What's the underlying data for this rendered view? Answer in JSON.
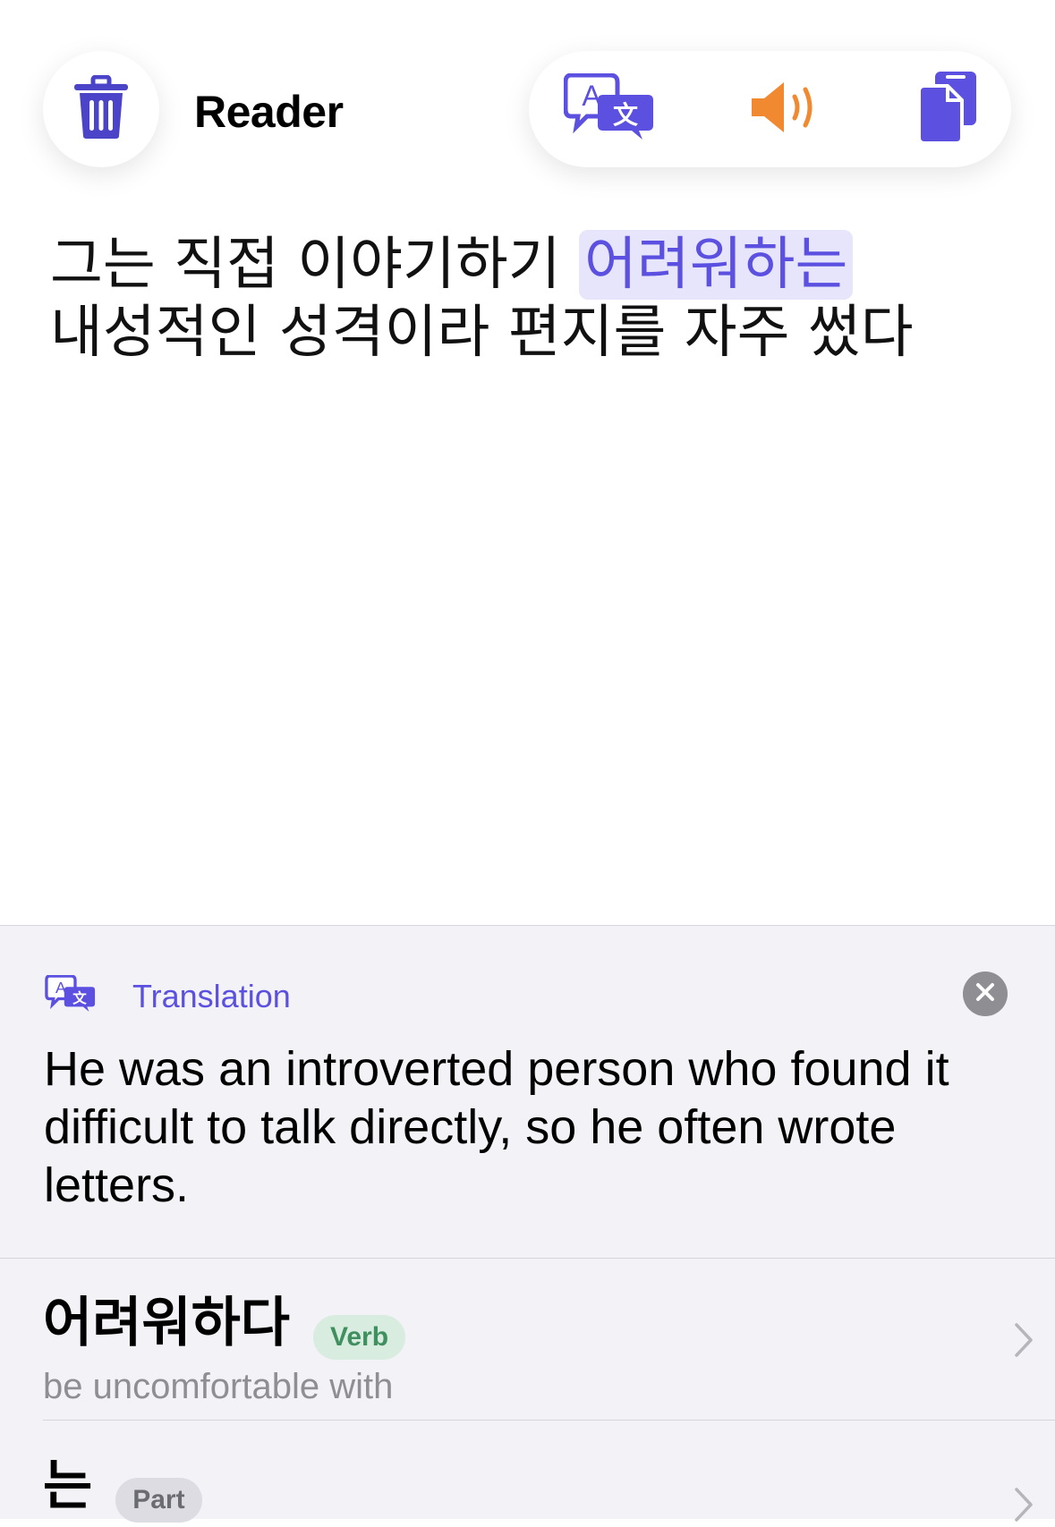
{
  "header": {
    "title": "Reader",
    "actions": [
      {
        "name": "translate",
        "icon": "translate-icon"
      },
      {
        "name": "speak",
        "icon": "speaker-icon"
      },
      {
        "name": "copy",
        "icon": "copy-icon"
      }
    ],
    "delete_icon": "trash-icon"
  },
  "sentence": {
    "before_line1": "그는 직접 이야기하기 ",
    "highlighted": "어려워하는",
    "line2": "내성적인 성격이라 편지를 자주 썼다"
  },
  "translation": {
    "label": "Translation",
    "text": "He was an introverted person who found it difficult to talk directly, so he often wrote letters."
  },
  "words": [
    {
      "word": "어려워하다",
      "pos": "Verb",
      "meaning": "be uncomfortable with"
    },
    {
      "word": "는",
      "pos": "Part",
      "meaning": ""
    }
  ],
  "colors": {
    "accent": "#5b50e0",
    "speaker": "#f0892f",
    "highlight_bg": "#e6e5fb",
    "verb_badge_bg": "#d8ece0",
    "verb_badge_text": "#3f8f5f",
    "part_badge_bg": "#dcdce2",
    "sheet_bg": "#f2f2f7"
  }
}
